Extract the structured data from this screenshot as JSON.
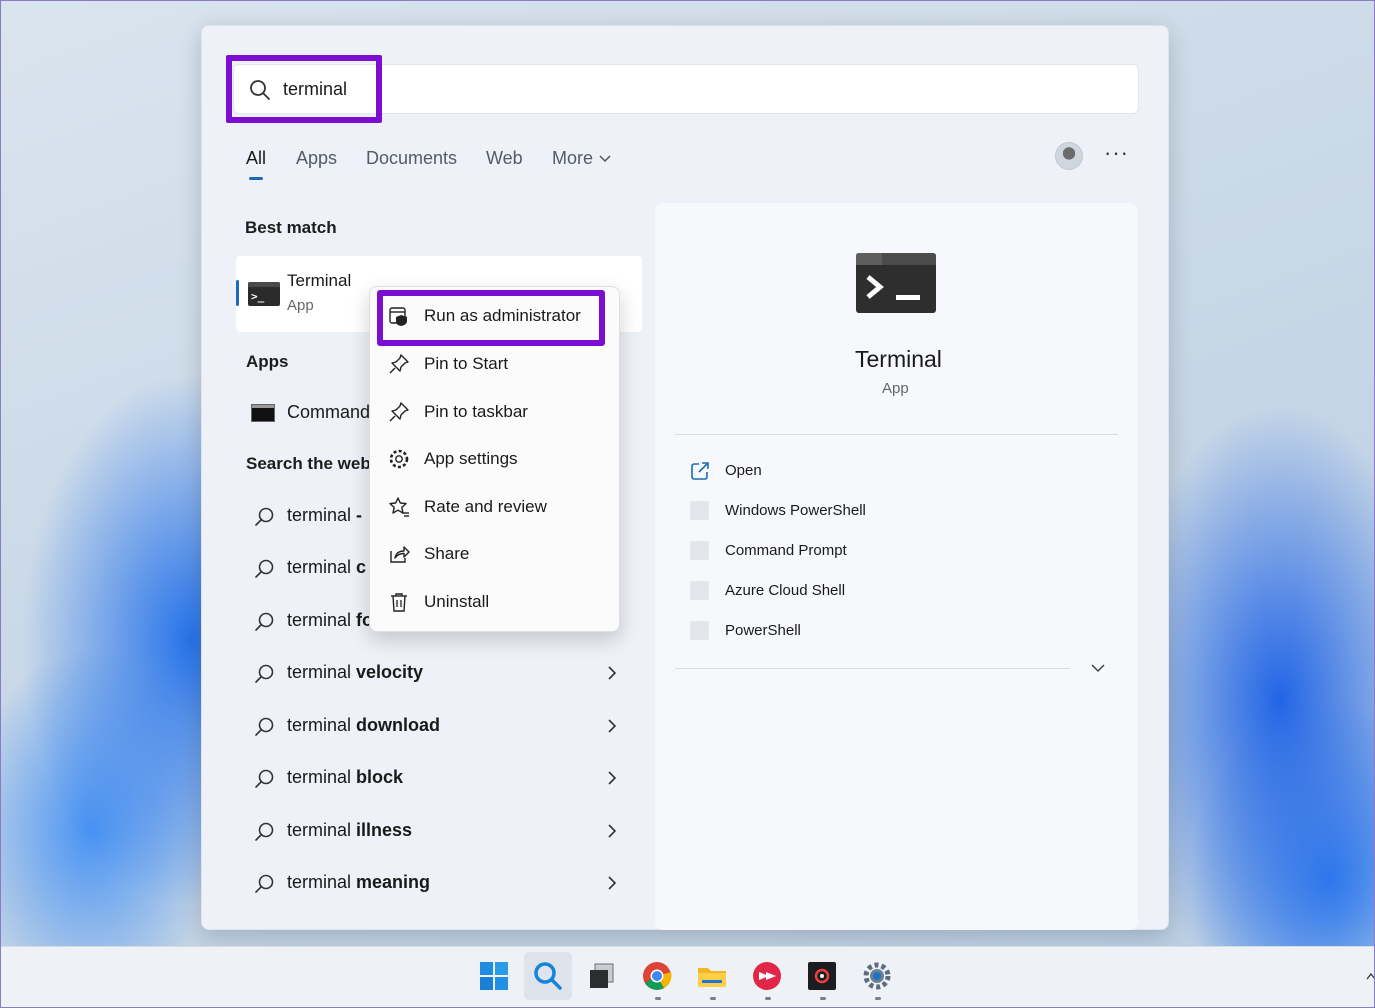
{
  "search": {
    "query": "terminal"
  },
  "tabs": [
    {
      "label": "All",
      "active": true
    },
    {
      "label": "Apps",
      "active": false
    },
    {
      "label": "Documents",
      "active": false
    },
    {
      "label": "Web",
      "active": false
    },
    {
      "label": "More",
      "active": false
    }
  ],
  "left": {
    "best_match_title": "Best match",
    "best_match": {
      "name": "Terminal",
      "type": "App"
    },
    "apps_title": "Apps",
    "apps": [
      {
        "name": "Command"
      }
    ],
    "web_title": "Search the web",
    "web_results": [
      {
        "prefix": "terminal",
        "bold": " - ",
        "arrow": false
      },
      {
        "prefix": "terminal",
        "bold": " c",
        "arrow": false
      },
      {
        "prefix": "terminal",
        "bold": " fo",
        "arrow": false
      },
      {
        "prefix": "terminal",
        "bold": " velocity",
        "arrow": true
      },
      {
        "prefix": "terminal",
        "bold": " download",
        "arrow": true
      },
      {
        "prefix": "terminal",
        "bold": " block",
        "arrow": true
      },
      {
        "prefix": "terminal",
        "bold": " illness",
        "arrow": true
      },
      {
        "prefix": "terminal",
        "bold": " meaning",
        "arrow": true
      }
    ]
  },
  "context_menu": {
    "items": [
      {
        "label": "Run as administrator",
        "icon": "shield-window-icon"
      },
      {
        "label": "Pin to Start",
        "icon": "pin-icon"
      },
      {
        "label": "Pin to taskbar",
        "icon": "pin-icon"
      },
      {
        "label": "App settings",
        "icon": "gear-icon"
      },
      {
        "label": "Rate and review",
        "icon": "star-review-icon"
      },
      {
        "label": "Share",
        "icon": "share-icon"
      },
      {
        "label": "Uninstall",
        "icon": "trash-icon"
      }
    ]
  },
  "detail": {
    "title": "Terminal",
    "subtitle": "App",
    "actions": [
      {
        "label": "Open",
        "icon": "open-external-icon"
      },
      {
        "label": "Windows PowerShell",
        "icon": "placeholder-icon"
      },
      {
        "label": "Command Prompt",
        "icon": "placeholder-icon"
      },
      {
        "label": "Azure Cloud Shell",
        "icon": "placeholder-icon"
      },
      {
        "label": "PowerShell",
        "icon": "placeholder-icon"
      }
    ]
  },
  "taskbar": {
    "icons": [
      "windows-start-icon",
      "search-icon",
      "task-view-icon",
      "chrome-icon",
      "file-explorer-icon",
      "app-red-icon",
      "app-dark-icon",
      "settings-gear-icon"
    ]
  },
  "colors": {
    "highlight": "#7a0fd1",
    "accent": "#1c6bb8"
  }
}
